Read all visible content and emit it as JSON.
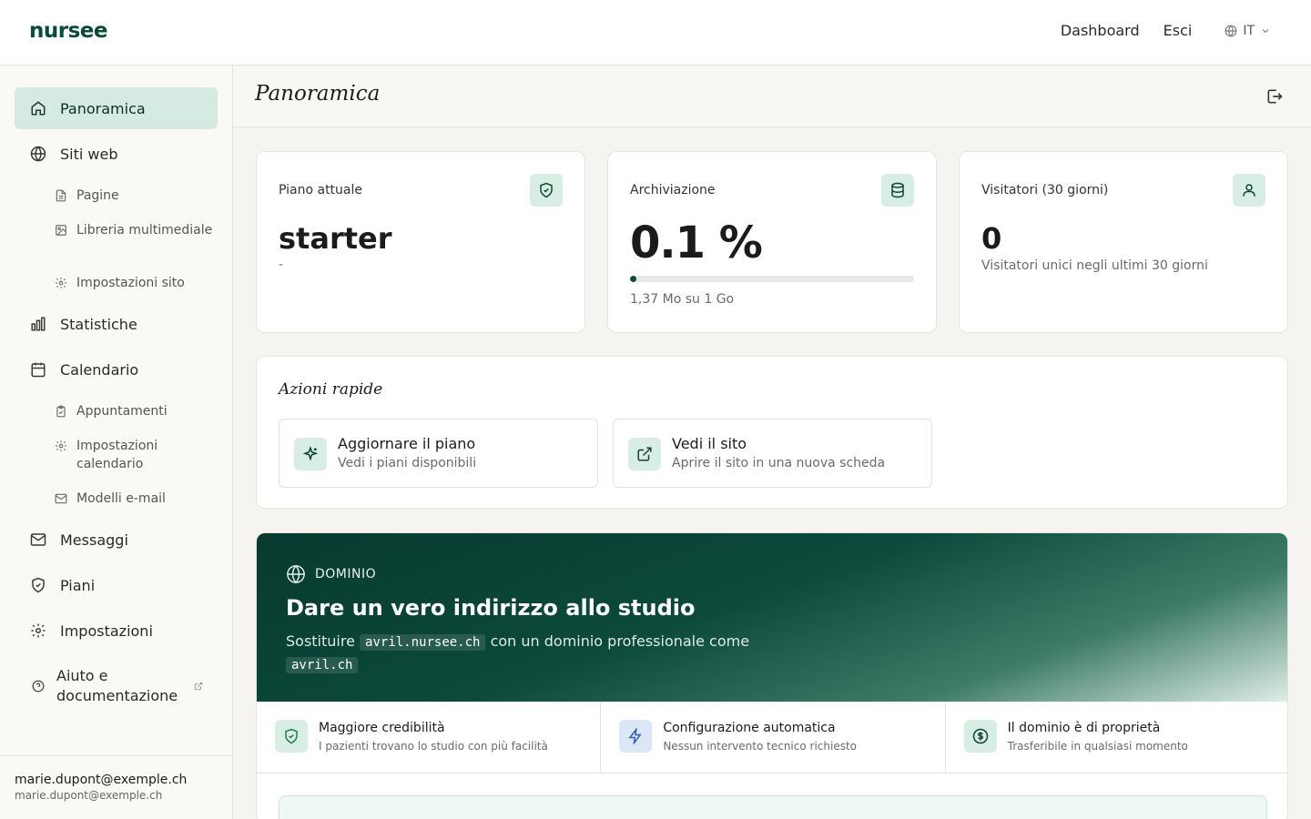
{
  "app": {
    "logo": "nursee"
  },
  "topnav": {
    "dashboard": "Dashboard",
    "logout": "Esci",
    "lang": "IT"
  },
  "sidebar": {
    "items": [
      {
        "label": "Panoramica",
        "icon": "home-icon",
        "active": true
      },
      {
        "label": "Siti web",
        "icon": "globe-icon"
      },
      {
        "label": "Statistiche",
        "icon": "bar-chart-icon"
      },
      {
        "label": "Calendario",
        "icon": "calendar-icon"
      },
      {
        "label": "Messaggi",
        "icon": "mail-icon"
      },
      {
        "label": "Piani",
        "icon": "shield-icon"
      },
      {
        "label": "Impostazioni",
        "icon": "gear-icon"
      },
      {
        "label": "Aiuto e documentazione",
        "icon": "help-icon"
      }
    ],
    "siti_sub": [
      {
        "label": "Pagine",
        "icon": "page-icon"
      },
      {
        "label": "Libreria multimediale",
        "icon": "image-icon"
      },
      {
        "label": "Impostazioni sito",
        "icon": "gear-icon"
      }
    ],
    "calendario_sub": [
      {
        "label": "Appuntamenti",
        "icon": "clipboard-icon"
      },
      {
        "label": "Impostazioni calendario",
        "icon": "gear-icon"
      },
      {
        "label": "Modelli e-mail",
        "icon": "mail-icon"
      }
    ],
    "user": {
      "name": "marie.dupont@exemple.ch",
      "email": "marie.dupont@exemple.ch"
    }
  },
  "page": {
    "title": "Panoramica"
  },
  "stats": {
    "plan": {
      "label": "Piano attuale",
      "value": "starter",
      "sub": "-"
    },
    "storage": {
      "label": "Archiviazione",
      "value": "0.1 %",
      "progress": 0.001,
      "sub": "1,37 Mo su 1 Go"
    },
    "visitors": {
      "label": "Visitatori (30 giorni)",
      "value": "0",
      "sub": "Visitatori unici negli ultimi 30 giorni"
    }
  },
  "quick_actions": {
    "title": "Azioni rapide",
    "items": [
      {
        "title": "Aggiornare il piano",
        "sub": "Vedi i piani disponibili",
        "icon": "sparkle-icon"
      },
      {
        "title": "Vedi il sito",
        "sub": "Aprire il sito in una nuova scheda",
        "icon": "external-link-icon"
      }
    ]
  },
  "domain": {
    "tag": "DOMINIO",
    "title": "Dare un vero indirizzo allo studio",
    "desc_prefix": "Sostituire",
    "current_domain": "avril.nursee.ch",
    "desc_middle": "con un dominio professionale come",
    "example_domain": "avril.ch",
    "benefits": [
      {
        "title": "Maggiore credibilità",
        "sub": "I pazienti trovano lo studio con più facilità",
        "icon": "shield-check-icon",
        "color": "#d8ede4"
      },
      {
        "title": "Configurazione automatica",
        "sub": "Nessun intervento tecnico richiesto",
        "icon": "lightning-icon",
        "color": "#dbe7f7"
      },
      {
        "title": "Il dominio è di proprietà",
        "sub": "Trasferibile in qualsiasi momento",
        "icon": "dollar-circle-icon",
        "color": "#d8ede4"
      }
    ]
  },
  "colors": {
    "brand": "#0b4a3a",
    "accent_bg": "#d5ebe2"
  }
}
